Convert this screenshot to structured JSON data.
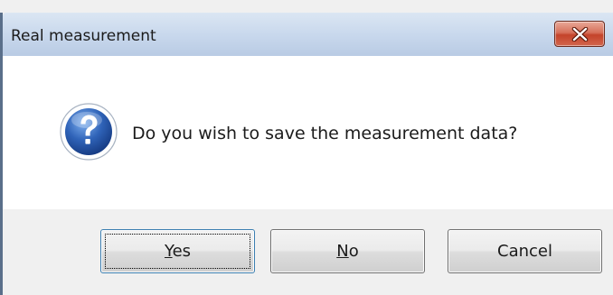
{
  "window": {
    "title": "Real measurement",
    "close_icon": "close-icon"
  },
  "message": {
    "icon": "question-icon",
    "text": "Do you wish to save the measurement data?"
  },
  "buttons": {
    "yes": {
      "mnemonic": "Y",
      "rest": "es"
    },
    "no": {
      "mnemonic": "N",
      "rest": "o"
    },
    "cancel": {
      "label": "Cancel"
    }
  },
  "colors": {
    "titlebar": "#c7d7ec",
    "close_button": "#c4432a",
    "icon_blue": "#2f63b8",
    "background": "#f0f0f0"
  }
}
